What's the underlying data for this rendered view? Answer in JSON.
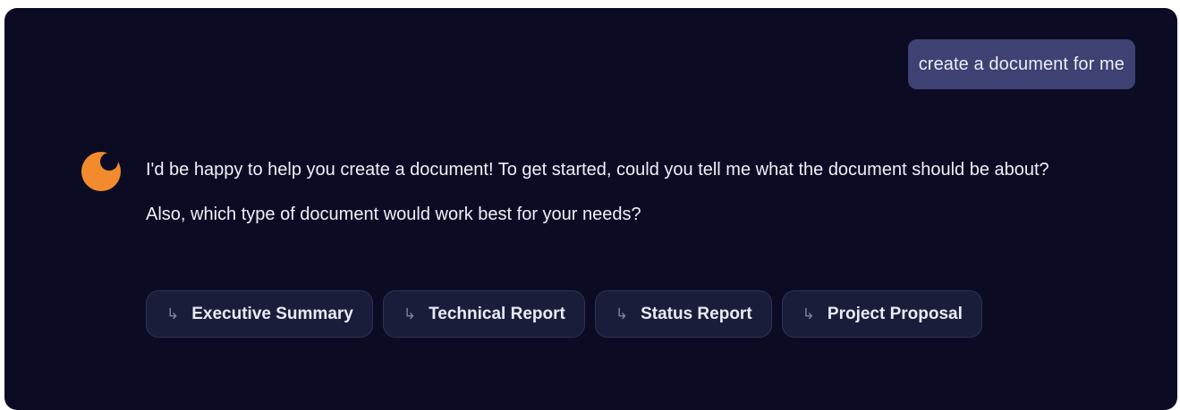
{
  "user_message": {
    "text": "create a document for me"
  },
  "assistant": {
    "avatar_icon": "crescent-moon-logo-icon",
    "avatar_color": "#f28a2e",
    "paragraphs": [
      "I'd be happy to help you create a document! To get started, could you tell me what the document should be about?",
      "Also, which type of document would work best for your needs?"
    ]
  },
  "suggestions": [
    {
      "icon": "reply-arrow-icon",
      "label": "Executive Summary"
    },
    {
      "icon": "reply-arrow-icon",
      "label": "Technical Report"
    },
    {
      "icon": "reply-arrow-icon",
      "label": "Status Report"
    },
    {
      "icon": "reply-arrow-icon",
      "label": "Project Proposal"
    }
  ],
  "colors": {
    "background": "#0b0c24",
    "user_bubble": "#3d4272",
    "chip_background": "#1a1d3a",
    "accent": "#f28a2e"
  }
}
